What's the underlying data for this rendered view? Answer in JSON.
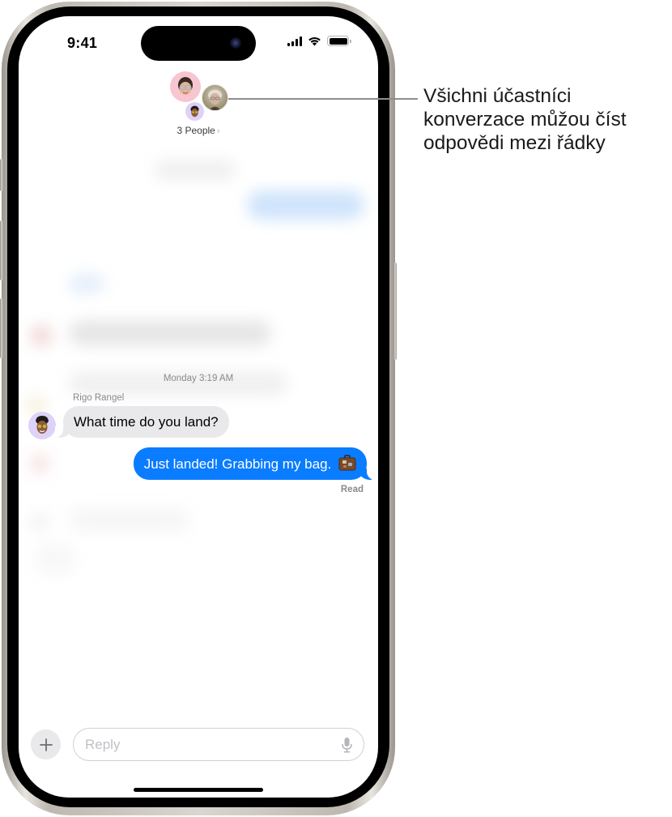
{
  "status_bar": {
    "time": "9:41",
    "icons": [
      "cellular-signal-icon",
      "wifi-icon",
      "battery-icon"
    ]
  },
  "conversation_header": {
    "participants_label": "3 People",
    "chevron": "›",
    "avatars": [
      "memoji-woman-glasses",
      "photo-person-gray-hair",
      "memoji-rigo"
    ]
  },
  "messages": {
    "timestamp_day": "Monday",
    "timestamp_time": "3:19 AM",
    "incoming": {
      "sender": "Rigo Rangel",
      "text": "What time do you land?"
    },
    "outgoing": {
      "text": "Just landed! Grabbing my bag.",
      "emoji": "briefcase-emoji",
      "status": "Read"
    }
  },
  "composer": {
    "placeholder": "Reply",
    "value": "",
    "plus_icon": "plus-icon",
    "mic_icon": "microphone-icon"
  },
  "callout": {
    "line1": "Všichni účastníci",
    "line2": "konverzace můžou číst",
    "line3": "odpovědi mezi řádky"
  },
  "colors": {
    "outgoing_bubble": "#0a7cff",
    "incoming_bubble": "#e9e9eb",
    "secondary_text": "#8a8a8e"
  }
}
